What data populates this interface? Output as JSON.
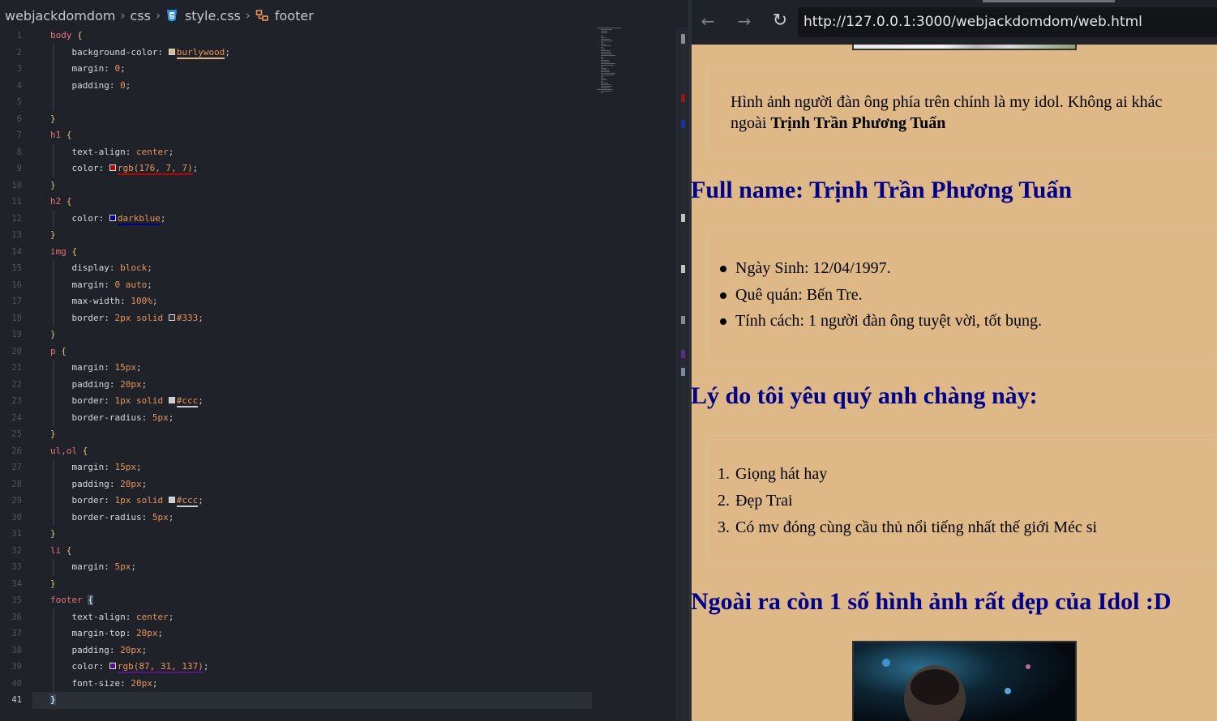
{
  "editor": {
    "breadcrumb": [
      "webjackdomdom",
      "css",
      "style.css",
      "footer"
    ],
    "lines": [
      {
        "n": "1",
        "tokens": [
          [
            "sel",
            "body "
          ],
          [
            "brace",
            "{"
          ]
        ]
      },
      {
        "n": "2",
        "tokens": [
          [
            "prop",
            "    background-color: "
          ],
          [
            "swatch",
            "#deb887"
          ],
          [
            "ul-tan",
            "burlywood"
          ],
          [
            "punc",
            ";"
          ]
        ]
      },
      {
        "n": "3",
        "tokens": [
          [
            "prop",
            "    margin: "
          ],
          [
            "num",
            "0"
          ],
          [
            "punc",
            ";"
          ]
        ]
      },
      {
        "n": "4",
        "tokens": [
          [
            "prop",
            "    padding: "
          ],
          [
            "num",
            "0"
          ],
          [
            "punc",
            ";"
          ]
        ]
      },
      {
        "n": "5",
        "tokens": []
      },
      {
        "n": "6",
        "tokens": [
          [
            "brace",
            "}"
          ]
        ]
      },
      {
        "n": "7",
        "tokens": [
          [
            "sel",
            "h1 "
          ],
          [
            "brace",
            "{"
          ]
        ]
      },
      {
        "n": "8",
        "tokens": [
          [
            "prop",
            "    text-align: "
          ],
          [
            "kw",
            "center"
          ],
          [
            "punc",
            ";"
          ]
        ]
      },
      {
        "n": "9",
        "tokens": [
          [
            "prop",
            "    color: "
          ],
          [
            "swatch",
            "#b00707"
          ],
          [
            "ul-red",
            "rgb(176, 7, 7)"
          ],
          [
            "punc",
            ";"
          ]
        ]
      },
      {
        "n": "10",
        "tokens": [
          [
            "brace",
            "}"
          ]
        ]
      },
      {
        "n": "11",
        "tokens": [
          [
            "sel",
            "h2 "
          ],
          [
            "brace",
            "{"
          ]
        ]
      },
      {
        "n": "12",
        "tokens": [
          [
            "prop",
            "    color: "
          ],
          [
            "swatch",
            "#00008b"
          ],
          [
            "ul-blue",
            "darkblue"
          ],
          [
            "punc",
            ";"
          ]
        ]
      },
      {
        "n": "13",
        "tokens": [
          [
            "brace",
            "}"
          ]
        ]
      },
      {
        "n": "14",
        "tokens": [
          [
            "sel",
            "img "
          ],
          [
            "brace",
            "{"
          ]
        ]
      },
      {
        "n": "15",
        "tokens": [
          [
            "prop",
            "    display: "
          ],
          [
            "kw",
            "block"
          ],
          [
            "punc",
            ";"
          ]
        ]
      },
      {
        "n": "16",
        "tokens": [
          [
            "prop",
            "    margin: "
          ],
          [
            "num",
            "0 "
          ],
          [
            "kw",
            "auto"
          ],
          [
            "punc",
            ";"
          ]
        ]
      },
      {
        "n": "17",
        "tokens": [
          [
            "prop",
            "    max-width: "
          ],
          [
            "num",
            "100%"
          ],
          [
            "punc",
            ";"
          ]
        ]
      },
      {
        "n": "18",
        "tokens": [
          [
            "prop",
            "    border: "
          ],
          [
            "num",
            "2px "
          ],
          [
            "kw",
            "solid "
          ],
          [
            "swatch",
            "#333333"
          ],
          [
            "num",
            "#333"
          ],
          [
            "punc",
            ";"
          ]
        ]
      },
      {
        "n": "19",
        "tokens": [
          [
            "brace",
            "}"
          ]
        ]
      },
      {
        "n": "20",
        "tokens": [
          [
            "sel",
            "p "
          ],
          [
            "brace",
            "{"
          ]
        ]
      },
      {
        "n": "21",
        "tokens": [
          [
            "prop",
            "    margin: "
          ],
          [
            "num",
            "15px"
          ],
          [
            "punc",
            ";"
          ]
        ]
      },
      {
        "n": "22",
        "tokens": [
          [
            "prop",
            "    padding: "
          ],
          [
            "num",
            "20px"
          ],
          [
            "punc",
            ";"
          ]
        ]
      },
      {
        "n": "23",
        "tokens": [
          [
            "prop",
            "    border: "
          ],
          [
            "num",
            "1px "
          ],
          [
            "kw",
            "solid "
          ],
          [
            "swatch",
            "#cccccc"
          ],
          [
            "ul-grey",
            "#ccc"
          ],
          [
            "punc",
            ";"
          ]
        ]
      },
      {
        "n": "24",
        "tokens": [
          [
            "prop",
            "    border-radius: "
          ],
          [
            "num",
            "5px"
          ],
          [
            "punc",
            ";"
          ]
        ]
      },
      {
        "n": "25",
        "tokens": [
          [
            "brace",
            "}"
          ]
        ]
      },
      {
        "n": "26",
        "tokens": [
          [
            "sel",
            "ul,ol "
          ],
          [
            "brace",
            "{"
          ]
        ]
      },
      {
        "n": "27",
        "tokens": [
          [
            "prop",
            "    margin: "
          ],
          [
            "num",
            "15px"
          ],
          [
            "punc",
            ";"
          ]
        ]
      },
      {
        "n": "28",
        "tokens": [
          [
            "prop",
            "    padding: "
          ],
          [
            "num",
            "20px"
          ],
          [
            "punc",
            ";"
          ]
        ]
      },
      {
        "n": "29",
        "tokens": [
          [
            "prop",
            "    border: "
          ],
          [
            "num",
            "1px "
          ],
          [
            "kw",
            "solid "
          ],
          [
            "swatch",
            "#cccccc"
          ],
          [
            "ul-grey",
            "#ccc"
          ],
          [
            "punc",
            ";"
          ]
        ]
      },
      {
        "n": "30",
        "tokens": [
          [
            "prop",
            "    border-radius: "
          ],
          [
            "num",
            "5px"
          ],
          [
            "punc",
            ";"
          ]
        ]
      },
      {
        "n": "31",
        "tokens": [
          [
            "brace",
            "}"
          ]
        ]
      },
      {
        "n": "32",
        "tokens": [
          [
            "sel",
            "li "
          ],
          [
            "brace",
            "{"
          ]
        ]
      },
      {
        "n": "33",
        "tokens": [
          [
            "prop",
            "    margin: "
          ],
          [
            "num",
            "5px"
          ],
          [
            "punc",
            ";"
          ]
        ]
      },
      {
        "n": "34",
        "tokens": [
          [
            "brace",
            "}"
          ]
        ]
      },
      {
        "n": "35",
        "tokens": [
          [
            "sel",
            "footer "
          ],
          [
            "cursor-brace",
            "{"
          ]
        ]
      },
      {
        "n": "36",
        "tokens": [
          [
            "prop",
            "    text-align: "
          ],
          [
            "kw",
            "center"
          ],
          [
            "punc",
            ";"
          ]
        ]
      },
      {
        "n": "37",
        "tokens": [
          [
            "prop",
            "    margin-top: "
          ],
          [
            "num",
            "20px"
          ],
          [
            "punc",
            ";"
          ]
        ]
      },
      {
        "n": "38",
        "tokens": [
          [
            "prop",
            "    padding: "
          ],
          [
            "num",
            "20px"
          ],
          [
            "punc",
            ";"
          ]
        ]
      },
      {
        "n": "39",
        "tokens": [
          [
            "prop",
            "    color: "
          ],
          [
            "swatch",
            "#57118a"
          ],
          [
            "ul-purple",
            "rgb(87, 31, 137)"
          ],
          [
            "punc",
            ";"
          ]
        ]
      },
      {
        "n": "40",
        "tokens": [
          [
            "prop",
            "    font-size: "
          ],
          [
            "num",
            "20px"
          ],
          [
            "punc",
            ";"
          ]
        ]
      },
      {
        "n": "41",
        "tokens": [
          [
            "cursor-brace",
            "}"
          ]
        ]
      }
    ]
  },
  "browser": {
    "url": "http://127.0.0.1:3000/webjackdomdom/web.html",
    "back_icon": "←",
    "forward_icon": "→",
    "reload_icon": "↻",
    "intro_text": "Hình ảnh người đàn ông phía trên chính là my idol. Không ai khác ngoài ",
    "intro_bold": "Trịnh Trần Phương Tuấn",
    "fullname_heading": "Full name: Trịnh Trần Phương Tuấn",
    "info_items": [
      "Ngày Sinh: 12/04/1997.",
      "Quê quán: Bến Tre.",
      "Tính cách: 1 người đàn ông tuyệt vời, tốt bụng."
    ],
    "reasons_heading": "Lý do tôi yêu quý anh chàng này:",
    "reasons": [
      "Giọng hát hay",
      "Đẹp Trai",
      "Có mv đóng cùng cầu thủ nổi tiếng nhất thế giới Méc si"
    ],
    "reason_numbers": [
      "1.",
      "2.",
      "3."
    ],
    "more_heading": "Ngoài ra còn 1 số hình ảnh rất đẹp của Idol :D"
  },
  "colors": {
    "page_bg": "#deb887",
    "heading": "#00008b",
    "editor_bg": "#1f2329"
  }
}
